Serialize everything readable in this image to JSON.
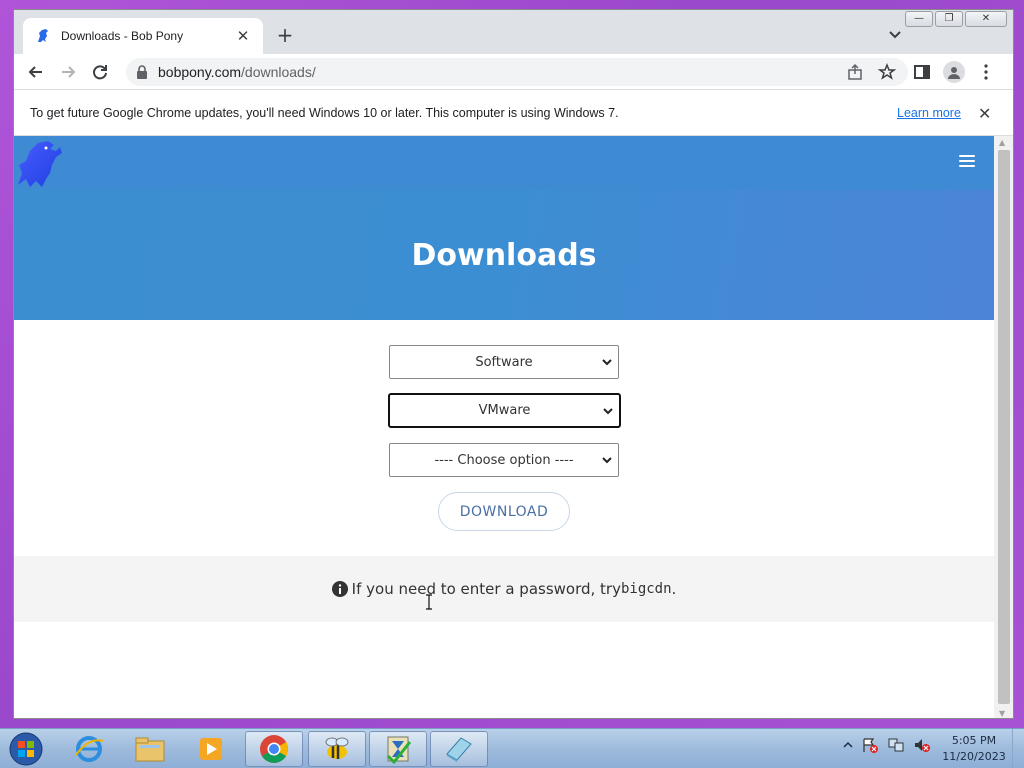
{
  "browser": {
    "tab": {
      "title": "Downloads - Bob Pony",
      "close": "✕"
    },
    "new_tab": "+",
    "address": {
      "host": "bobpony.com",
      "path": "/downloads/"
    },
    "window_controls": {
      "minimize": "—",
      "maximize": "❐",
      "close": "✕"
    },
    "infobar": {
      "message": "To get future Google Chrome updates, you'll need Windows 10 or later. This computer is using Windows 7.",
      "link": "Learn more",
      "close": "✕"
    }
  },
  "page": {
    "heading": "Downloads",
    "selects": [
      {
        "value": "Software"
      },
      {
        "value": "VMware"
      },
      {
        "value": "---- Choose option ----"
      }
    ],
    "download_button": "DOWNLOAD",
    "note": {
      "text": "If you need to enter a password, try ",
      "code": "bigcdn",
      "suffix": "."
    }
  },
  "taskbar": {
    "items": [
      "start-orb",
      "internet-explorer",
      "file-explorer",
      "media-player",
      "chrome",
      "bee-app",
      "hourglass-app",
      "notepad-app"
    ],
    "clock": {
      "time": "5:05 PM",
      "date": "11/20/2023"
    }
  },
  "colors": {
    "accent": "#3f8bd3",
    "hero": "#3c8ed2",
    "link": "#1a73e8"
  }
}
